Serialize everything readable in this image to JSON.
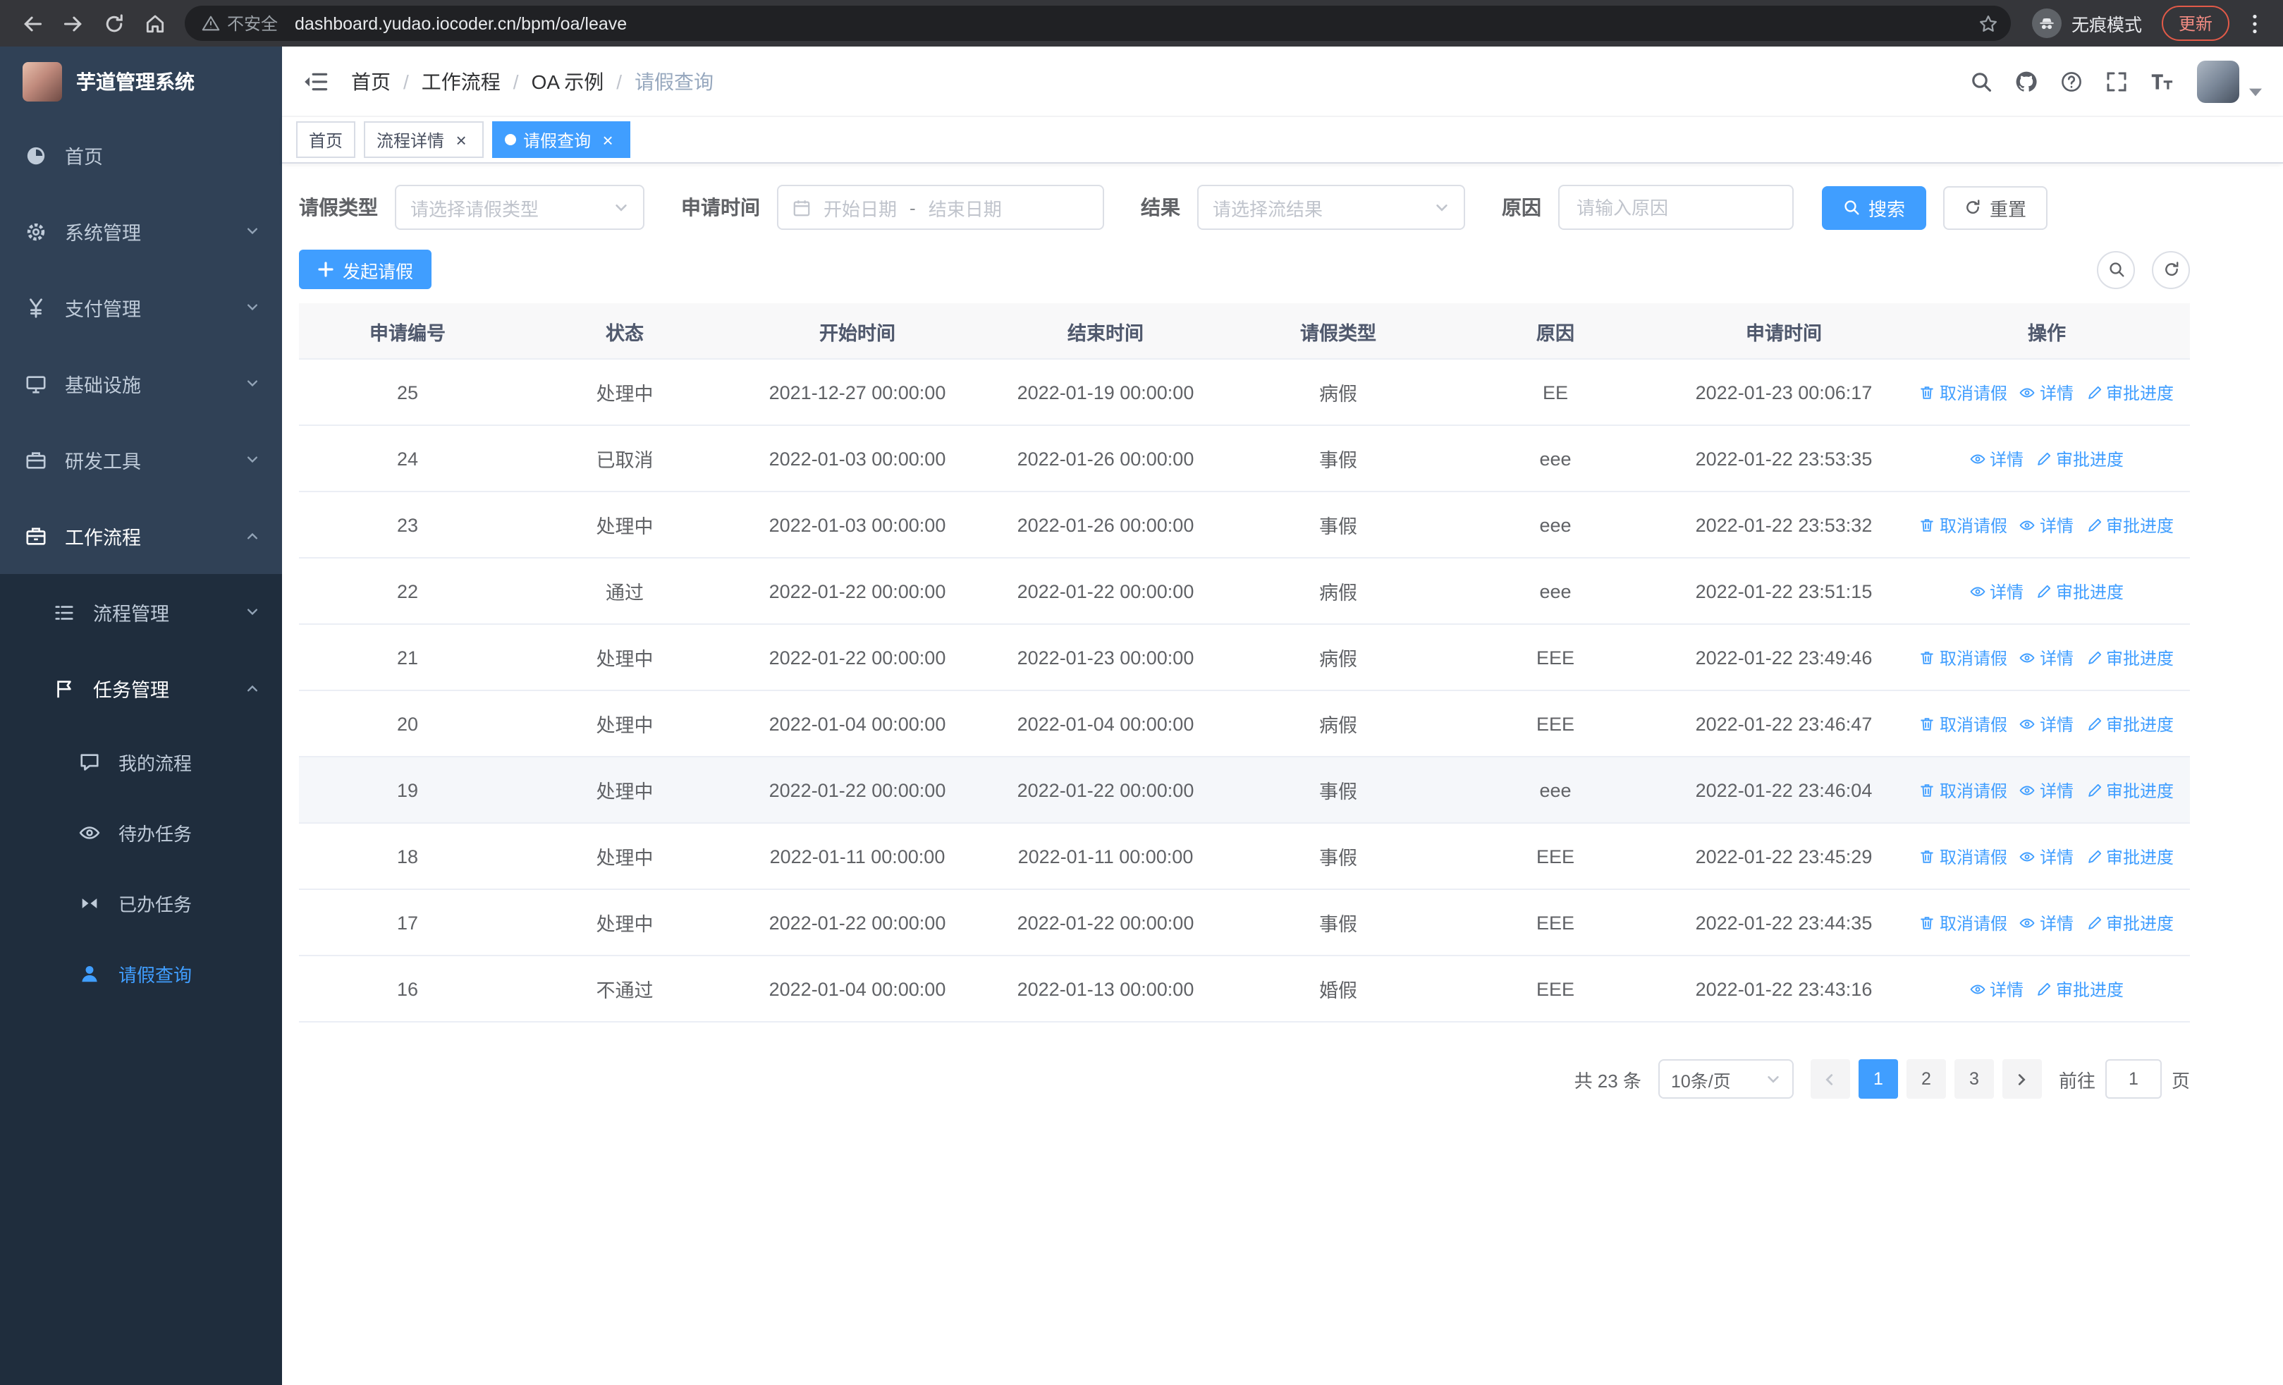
{
  "browser": {
    "security_label": "不安全",
    "url": "dashboard.yudao.iocoder.cn/bpm/oa/leave",
    "incognito_label": "无痕模式",
    "update_label": "更新"
  },
  "theme": {
    "accent": "#409eff",
    "sidebar-bg": "#304156",
    "submenu-bg": "#1f2d3d",
    "sidebar-text": "#bfcbd9",
    "chrome-bg": "#35363a",
    "omnibox-bg": "#202124",
    "header-row-bg": "#f8f8f9",
    "update-color": "#f28b82"
  },
  "sidebar": {
    "logo_title": "芋道管理系统",
    "menu": [
      {
        "name": "home",
        "label": "首页",
        "icon": "dashboard-icon"
      },
      {
        "name": "system",
        "label": "系统管理",
        "icon": "gear-icon",
        "arrow": "down"
      },
      {
        "name": "payment",
        "label": "支付管理",
        "icon": "yen-icon",
        "arrow": "down"
      },
      {
        "name": "infrastructure",
        "label": "基础设施",
        "icon": "infra-icon",
        "arrow": "down"
      },
      {
        "name": "devtools",
        "label": "研发工具",
        "icon": "tools-icon",
        "arrow": "down"
      },
      {
        "name": "workflow",
        "label": "工作流程",
        "icon": "workflow-icon",
        "arrow": "up",
        "expanded": true,
        "children": [
          {
            "name": "process-management",
            "label": "流程管理",
            "icon": "process-icon",
            "arrow": "down"
          },
          {
            "name": "task-management",
            "label": "任务管理",
            "icon": "task-icon",
            "arrow": "up",
            "expanded": true,
            "children": [
              {
                "name": "my-process",
                "label": "我的流程",
                "icon": "message-icon"
              },
              {
                "name": "todo-tasks",
                "label": "待办任务",
                "icon": "eye-icon"
              },
              {
                "name": "done-tasks",
                "label": "已办任务",
                "icon": "done-icon"
              },
              {
                "name": "leave-query",
                "label": "请假查询",
                "icon": "user-icon",
                "active": true
              }
            ]
          }
        ]
      }
    ]
  },
  "header": {
    "breadcrumb": [
      "首页",
      "工作流程",
      "OA 示例",
      "请假查询"
    ]
  },
  "tabs": [
    {
      "name": "home",
      "label": "首页",
      "closable": false,
      "active": false
    },
    {
      "name": "process-detail",
      "label": "流程详情",
      "closable": true,
      "active": false
    },
    {
      "name": "leave-query",
      "label": "请假查询",
      "closable": true,
      "active": true
    }
  ],
  "filters": {
    "leave_type_label": "请假类型",
    "leave_type_placeholder": "请选择请假类型",
    "apply_time_label": "申请时间",
    "start_date_placeholder": "开始日期",
    "range_separator": "-",
    "end_date_placeholder": "结束日期",
    "result_label": "结果",
    "result_placeholder": "请选择流结果",
    "reason_label": "原因",
    "reason_placeholder": "请输入原因",
    "search_button": "搜索",
    "reset_button": "重置"
  },
  "toolbar": {
    "create_button": "发起请假"
  },
  "table": {
    "columns": [
      "申请编号",
      "状态",
      "开始时间",
      "结束时间",
      "请假类型",
      "原因",
      "申请时间",
      "操作"
    ],
    "action_defs": [
      {
        "key": "cancel",
        "label": "取消请假",
        "icon": "delete-icon"
      },
      {
        "key": "detail",
        "label": "详情",
        "icon": "eye-icon"
      },
      {
        "key": "progress",
        "label": "审批进度",
        "icon": "edit-icon"
      }
    ],
    "rows": [
      {
        "id": "25",
        "status": "处理中",
        "start": "2021-12-27 00:00:00",
        "end": "2022-01-19 00:00:00",
        "type": "病假",
        "reason": "EE",
        "applied": "2022-01-23 00:06:17",
        "actions": [
          "cancel",
          "detail",
          "progress"
        ]
      },
      {
        "id": "24",
        "status": "已取消",
        "start": "2022-01-03 00:00:00",
        "end": "2022-01-26 00:00:00",
        "type": "事假",
        "reason": "eee",
        "applied": "2022-01-22 23:53:35",
        "actions": [
          "detail",
          "progress"
        ]
      },
      {
        "id": "23",
        "status": "处理中",
        "start": "2022-01-03 00:00:00",
        "end": "2022-01-26 00:00:00",
        "type": "事假",
        "reason": "eee",
        "applied": "2022-01-22 23:53:32",
        "actions": [
          "cancel",
          "detail",
          "progress"
        ]
      },
      {
        "id": "22",
        "status": "通过",
        "start": "2022-01-22 00:00:00",
        "end": "2022-01-22 00:00:00",
        "type": "病假",
        "reason": "eee",
        "applied": "2022-01-22 23:51:15",
        "actions": [
          "detail",
          "progress"
        ]
      },
      {
        "id": "21",
        "status": "处理中",
        "start": "2022-01-22 00:00:00",
        "end": "2022-01-23 00:00:00",
        "type": "病假",
        "reason": "EEE",
        "applied": "2022-01-22 23:49:46",
        "actions": [
          "cancel",
          "detail",
          "progress"
        ]
      },
      {
        "id": "20",
        "status": "处理中",
        "start": "2022-01-04 00:00:00",
        "end": "2022-01-04 00:00:00",
        "type": "病假",
        "reason": "EEE",
        "applied": "2022-01-22 23:46:47",
        "actions": [
          "cancel",
          "detail",
          "progress"
        ]
      },
      {
        "id": "19",
        "status": "处理中",
        "start": "2022-01-22 00:00:00",
        "end": "2022-01-22 00:00:00",
        "type": "事假",
        "reason": "eee",
        "applied": "2022-01-22 23:46:04",
        "actions": [
          "cancel",
          "detail",
          "progress"
        ],
        "highlighted": true
      },
      {
        "id": "18",
        "status": "处理中",
        "start": "2022-01-11 00:00:00",
        "end": "2022-01-11 00:00:00",
        "type": "事假",
        "reason": "EEE",
        "applied": "2022-01-22 23:45:29",
        "actions": [
          "cancel",
          "detail",
          "progress"
        ]
      },
      {
        "id": "17",
        "status": "处理中",
        "start": "2022-01-22 00:00:00",
        "end": "2022-01-22 00:00:00",
        "type": "事假",
        "reason": "EEE",
        "applied": "2022-01-22 23:44:35",
        "actions": [
          "cancel",
          "detail",
          "progress"
        ]
      },
      {
        "id": "16",
        "status": "不通过",
        "start": "2022-01-04 00:00:00",
        "end": "2022-01-13 00:00:00",
        "type": "婚假",
        "reason": "EEE",
        "applied": "2022-01-22 23:43:16",
        "actions": [
          "detail",
          "progress"
        ]
      }
    ]
  },
  "pagination": {
    "total_label": "共 23 条",
    "page_size": "10条/页",
    "pages": [
      "1",
      "2",
      "3"
    ],
    "active_page": "1",
    "goto_label": "前往",
    "goto_value": "1",
    "goto_suffix": "页"
  }
}
